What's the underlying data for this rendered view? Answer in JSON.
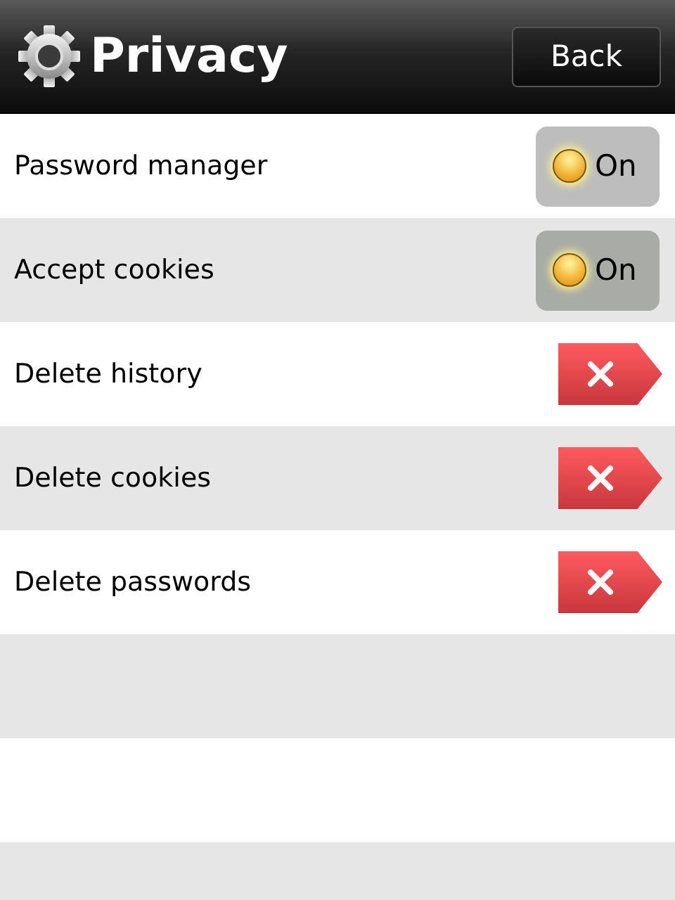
{
  "header": {
    "title": "Privacy",
    "back_button": "Back"
  },
  "settings": [
    {
      "kind": "toggle",
      "label": "Password manager",
      "value": "On",
      "on": true
    },
    {
      "kind": "toggle",
      "label": "Accept cookies",
      "value": "On",
      "on": true
    },
    {
      "kind": "delete",
      "label": "Delete history"
    },
    {
      "kind": "delete",
      "label": "Delete cookies"
    },
    {
      "kind": "delete",
      "label": "Delete passwords"
    }
  ]
}
